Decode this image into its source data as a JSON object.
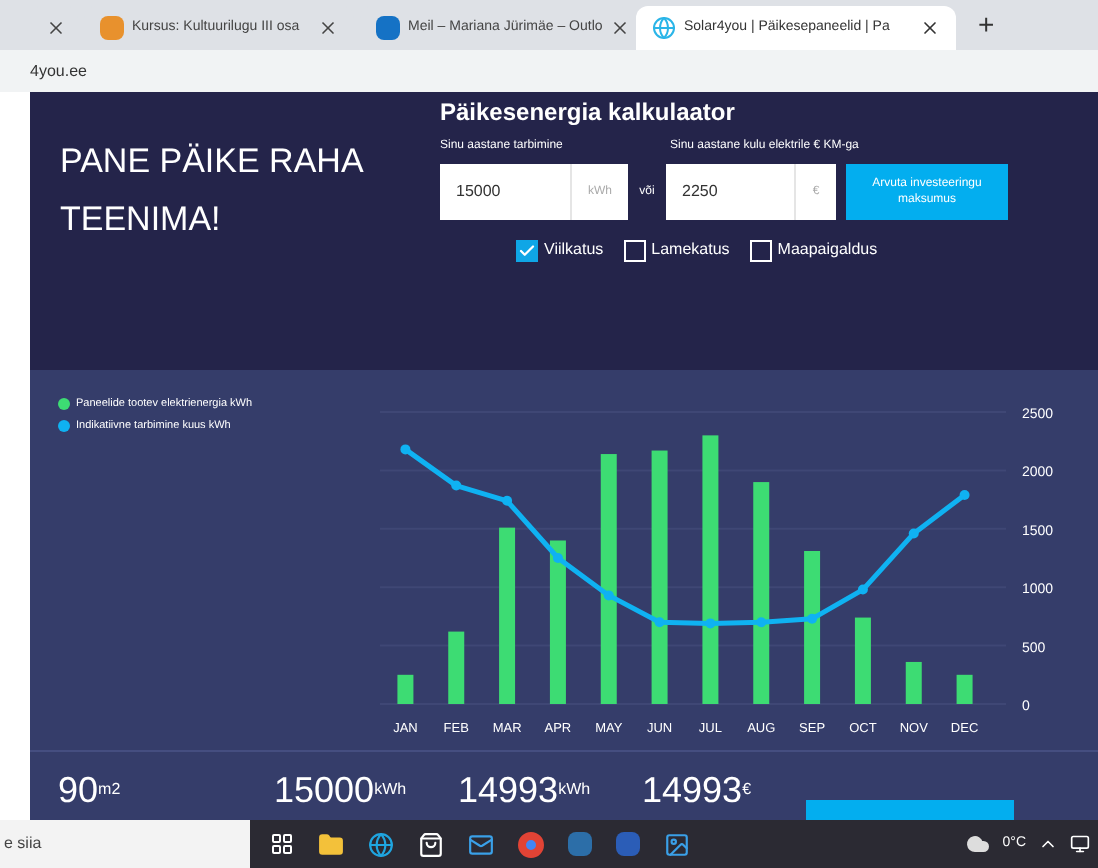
{
  "browser": {
    "tabs": [
      {
        "selected": false
      },
      {
        "title": "Kursus: Kultuurilugu III osa",
        "selected": false
      },
      {
        "title": "Meil – Mariana Jürimäe – Outlo",
        "selected": false
      },
      {
        "title": "Solar4you | Päikesepaneelid | Pa",
        "selected": true
      }
    ],
    "new_tab": "+",
    "address": "4you.ee"
  },
  "hero": {
    "headline": "PANE PÄIKE RAHA TEENIMA!"
  },
  "calculator": {
    "title": "Päikesenergia kalkulaator",
    "consumption_label": "Sinu aastane tarbimine",
    "cost_label": "Sinu aastane kulu elektrile € KM-ga",
    "consumption": {
      "value": "15000",
      "unit": "kWh"
    },
    "separator": "või",
    "cost": {
      "value": "2250",
      "unit": "€"
    },
    "button": "Arvuta investeeringu maksumus",
    "options": [
      {
        "label": "Viilkatus",
        "checked": true
      },
      {
        "label": "Lamekatus",
        "checked": false
      },
      {
        "label": "Maapaigaldus",
        "checked": false
      }
    ]
  },
  "chart_data": {
    "type": "bar",
    "categories": [
      "JAN",
      "FEB",
      "MAR",
      "APR",
      "MAY",
      "JUN",
      "JUL",
      "AUG",
      "SEP",
      "OCT",
      "NOV",
      "DEC"
    ],
    "ylim": [
      0,
      2500
    ],
    "yticks": [
      0,
      500,
      1000,
      1500,
      2000,
      2500
    ],
    "grid": true,
    "series": [
      {
        "name": "Paneelide tootev elektrienergia kWh",
        "color": "#3ddc73",
        "values": [
          250,
          620,
          1510,
          1400,
          2140,
          2170,
          2300,
          1900,
          1310,
          740,
          360,
          250
        ]
      },
      {
        "name": "Indikatiivne tarbimine kuus kWh",
        "color": "#0fb2f2",
        "type": "line",
        "marker": "circle",
        "values": [
          2180,
          1870,
          1740,
          1250,
          930,
          700,
          690,
          700,
          730,
          980,
          1460,
          1790
        ]
      }
    ]
  },
  "stats": [
    "90$^{m2}$",
    "15000$^{kWh}$",
    "14993$^{kWh}$",
    "14993$^{€}$"
  ],
  "taskbar": {
    "search": "e siia",
    "weather": "0°C"
  }
}
